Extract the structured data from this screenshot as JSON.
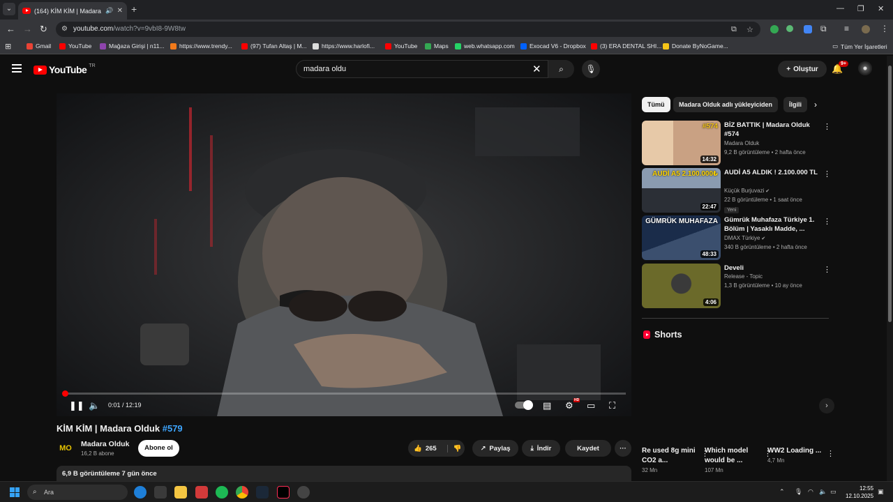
{
  "browser": {
    "tab_title": "(164) KİM KİM | Madara Ol...",
    "url_domain": "youtube.com",
    "url_path": "/watch?v=9vbI8-9W8tw",
    "bookmarks": [
      {
        "label": "Gmail",
        "color": "#ea4335"
      },
      {
        "label": "YouTube",
        "color": "#ff0000"
      },
      {
        "label": "Mağaza Girişi | n11...",
        "color": "#8e44ad"
      },
      {
        "label": "https://www.trendy...",
        "color": "#f27a1a"
      },
      {
        "label": "(97) Tufan Altaş | M...",
        "color": "#ff0000"
      },
      {
        "label": "https://www.harlofi...",
        "color": "#dddddd"
      },
      {
        "label": "YouTube",
        "color": "#ff0000"
      },
      {
        "label": "Maps",
        "color": "#34a853"
      },
      {
        "label": "web.whatsapp.com",
        "color": "#25d366"
      },
      {
        "label": "Exocad V6 - Dropbox",
        "color": "#0061ff"
      },
      {
        "label": "(3) ERA DENTAL SHI...",
        "color": "#ff0000"
      },
      {
        "label": "Donate ByNoGame...",
        "color": "#f5c518"
      }
    ],
    "all_bookmarks": "Tüm Yer İşaretleri"
  },
  "youtube": {
    "logo_text": "YouTube",
    "logo_country": "TR",
    "search_value": "madara oldu",
    "create_label": "Oluştur",
    "notification_count": "9+"
  },
  "player": {
    "current_time": "0:01 / 12:19",
    "progress": 0.0014
  },
  "video": {
    "title": "KİM KİM | Madara Olduk",
    "hashtag": "#579",
    "channel": "Madara Olduk",
    "channel_initials": "MO",
    "subscribers": "16,2 B abone",
    "subscribe_label": "Abone ol",
    "likes": "265",
    "share_label": "Paylaş",
    "download_label": "İndir",
    "save_label": "Kaydet",
    "views_date": "6,9 B görüntüleme  7 gün önce"
  },
  "chips": [
    "Tümü",
    "Madara Olduk adlı yükleyiciden",
    "İlgili"
  ],
  "recommendations": [
    {
      "title": "BİZ BATTIK | Madara Olduk #574",
      "channel": "Madara Olduk",
      "meta": "9,2 B görüntüleme • 2 hafta önce",
      "duration": "14:32",
      "thumb_text": "#574",
      "verified": false,
      "new": ""
    },
    {
      "title": "AUDİ A5 ALDIK ! 2.100.000 TL",
      "channel": "Küçük Burjuvazi",
      "meta": "22 B görüntüleme • 1 saat önce",
      "duration": "22:47",
      "thumb_text": "AUDİ A5 2.100.000₺",
      "verified": true,
      "new": "Yeni"
    },
    {
      "title": "Gümrük Muhafaza Türkiye 1. Bölüm | Yasaklı Madde, ...",
      "channel": "DMAX Türkiye",
      "meta": "340 B görüntüleme • 2 hafta önce",
      "duration": "48:33",
      "thumb_text": "GÜMRÜK MUHAFAZA",
      "verified": true,
      "new": ""
    },
    {
      "title": "Develi",
      "channel": "Release - Topic",
      "meta": "1,3 B görüntüleme • 10 ay önce",
      "duration": "4:06",
      "thumb_text": "",
      "verified": false,
      "new": ""
    }
  ],
  "shorts": {
    "heading": "Shorts",
    "items": [
      {
        "title": "Re used 8g mini CO2 a...",
        "views": "32 Mn"
      },
      {
        "title": "Which model would be ...",
        "views": "107 Mn"
      },
      {
        "title": "WW2 Loading ...",
        "views": "4,7 Mn"
      }
    ]
  },
  "taskbar": {
    "search_placeholder": "Ara",
    "time": "12:55",
    "date": "12.10.2025"
  },
  "colors": {
    "youtube_red": "#ff0000",
    "link_blue": "#3ea6ff",
    "bg": "#0f0f0f"
  }
}
